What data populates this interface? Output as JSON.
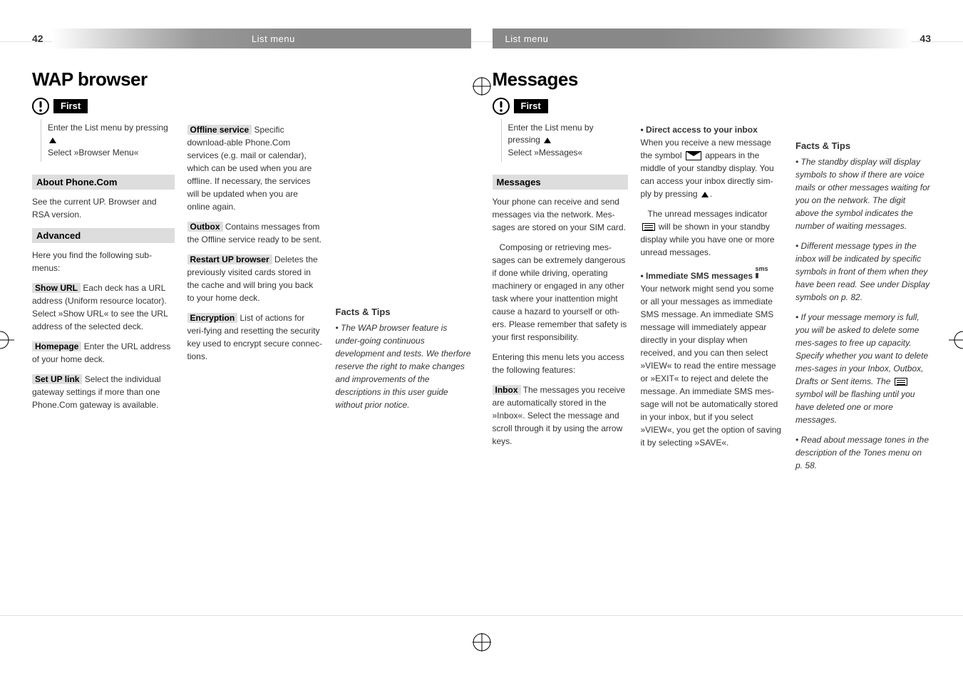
{
  "left_page": {
    "number": "42",
    "header": "List menu",
    "h1": "WAP browser",
    "first_title": "First",
    "first_body_line1": "Enter the List menu by pressing",
    "first_body_line2": "Select »Browser Menu«",
    "about_title": "About Phone.Com",
    "about_body": "See the current UP. Browser and RSA version.",
    "advanced_title": "Advanced",
    "advanced_intro": "Here you find the following sub-menus:",
    "show_url_label": "Show URL",
    "show_url_body": " Each deck has a URL address (Uniform resource locator). Select »Show URL« to see the URL  address of the selected deck.",
    "homepage_label": "Homepage",
    "homepage_body": " Enter the URL address of your home deck.",
    "setup_label": "Set UP link",
    "setup_body": " Select the individual gateway settings if more than one Phone.Com gateway is available.",
    "offline_label": "Offline service",
    "offline_body": " Specific download-able Phone.Com services (e.g. mail or calendar), which can be used when you are offline. If necessary, the services will be updated when you are online again.",
    "outbox_label": "Outbox",
    "outbox_body": " Contains messages from the Offline service ready to be sent.",
    "restart_label": "Restart UP browser",
    "restart_body": " Deletes the previously visited cards stored in the cache and will bring you back to your home deck.",
    "encryption_label": "Encryption",
    "encryption_body": " List of actions for veri-fying and resetting the security key used to encrypt secure connec-tions.",
    "facts_title": "Facts & Tips",
    "facts_body": "• The WAP browser feature is under-going continuous development and tests. We therfore reserve the right to make changes and improvements of the descriptions in this user guide without prior notice."
  },
  "right_page": {
    "number": "43",
    "header": "List menu",
    "h1": "Messages",
    "first_title": "First",
    "first_body_line1": "Enter the List menu by pressing",
    "first_body_line2": "Select »Messages«",
    "messages_title": "Messages",
    "messages_p1": "Your phone can receive and send messages via the network. Mes-sages are stored on your SIM card.",
    "messages_p2": "Composing or retrieving mes-sages can be extremely dangerous if done while driving, operating machinery or engaged in any other task where your inattention might cause a hazard to yourself or oth-ers.  Please remember that safety is your first responsibility.",
    "messages_p3": "Entering this menu lets you access the following features:",
    "inbox_label": "Inbox",
    "inbox_body": " The messages you receive are automatically stored in the »Inbox«. Select the message and scroll through it by using the arrow keys.",
    "direct_title": "• Direct access to your inbox",
    "direct_p1a": "When you receive a new message the symbol ",
    "direct_p1b": " appears in the middle of your standby display. You can access your inbox directly sim-ply by pressing ",
    "direct_p1c": ".",
    "direct_p2a": "The unread messages indicator ",
    "direct_p2b": " will be shown in your standby display while you have one or more unread messages.",
    "imm_title": "• Immediate SMS messages",
    "imm_body": "Your network might send you some or all your messages as immediate SMS message. An immediate SMS message will immediately appear directly in your display when received, and you can then select »VIEW« to read the entire message or »EXIT« to reject and delete the message. An immediate SMS mes-sage will not be automatically stored in your inbox, but if you select »VIEW«, you get the option of saving it by selecting »SAVE«.",
    "facts_title": "Facts & Tips",
    "facts_1": "• The standby display will display symbols to show if there are voice mails or other messages waiting for you on the network. The digit above the symbol indicates the number of waiting messages.",
    "facts_2": "• Different message types in the inbox will be indicated by specific symbols in front of them when they have been read. See under Display symbols on p. 82.",
    "facts_3a": "• If your message memory is full, you will be asked to delete some mes-sages to free up capacity. Specify whether you want to delete mes-sages in your Inbox, Outbox, Drafts or Sent items. The ",
    "facts_3b": " symbol will be flashing until you have deleted one or more messages.",
    "facts_4": "• Read about message tones in the description of the Tones menu on p. 58."
  }
}
